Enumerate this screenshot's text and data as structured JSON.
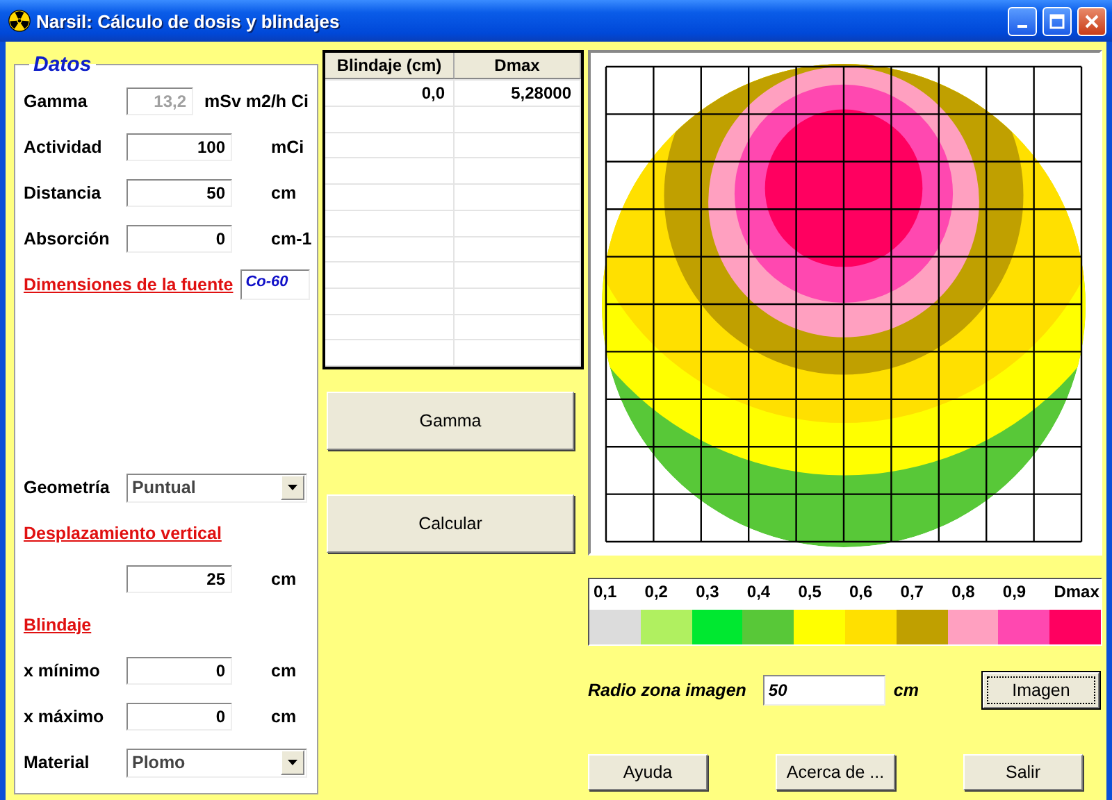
{
  "window": {
    "title": "Narsil: Cálculo de dosis y blindajes"
  },
  "datos": {
    "title": "Datos",
    "top": [
      {
        "kind": "field",
        "label": "Gamma",
        "value": "13,2",
        "unit": "mSv m2/h Ci",
        "disabled": true
      },
      {
        "kind": "field",
        "label": "Actividad",
        "value": "100",
        "unit": "mCi",
        "disabled": false
      },
      {
        "kind": "field",
        "label": "Distancia",
        "value": "50",
        "unit": "cm",
        "disabled": false
      },
      {
        "kind": "field",
        "label": "Absorción",
        "value": "0",
        "unit": "cm-1",
        "disabled": false
      },
      {
        "kind": "heading",
        "label": "Dimensiones de la fuente",
        "value": "Co-60"
      }
    ],
    "bottom": [
      {
        "kind": "select",
        "label": "Geometría",
        "value": "Puntual"
      },
      {
        "kind": "heading",
        "label": "Desplazamiento vertical"
      },
      {
        "kind": "field",
        "value": "25",
        "unit": "cm",
        "disabled": false
      },
      {
        "kind": "heading",
        "label": "Blindaje"
      },
      {
        "kind": "field",
        "label": "x mínimo",
        "value": "0",
        "unit": "cm",
        "disabled": false
      },
      {
        "kind": "field",
        "label": "x máximo",
        "value": "0",
        "unit": "cm",
        "disabled": false
      },
      {
        "kind": "select",
        "label": "Material",
        "value": "Plomo"
      }
    ]
  },
  "table": {
    "columns": [
      "Blindaje (cm)",
      "Dmax"
    ],
    "rows": [
      [
        "0,0",
        "5,28000"
      ]
    ]
  },
  "actions": [
    "Gamma",
    "Calcular"
  ],
  "legend": [
    {
      "label": "0,1",
      "color": "#dcdcdc"
    },
    {
      "label": "0,2",
      "color": "#b0f060"
    },
    {
      "label": "0,3",
      "color": "#00e830"
    },
    {
      "label": "0,4",
      "color": "#58c838"
    },
    {
      "label": "0,5",
      "color": "#ffff00"
    },
    {
      "label": "0,6",
      "color": "#ffe000"
    },
    {
      "label": "0,7",
      "color": "#c0a000"
    },
    {
      "label": "0,8",
      "color": "#ffa0c0"
    },
    {
      "label": "0,9",
      "color": "#ff48b0"
    },
    {
      "label": "Dmax",
      "color": "#ff0060"
    }
  ],
  "radius": {
    "label": "Radio zona imagen",
    "value": "50",
    "unit": "cm",
    "button": "Imagen",
    "focused": true
  },
  "footer": [
    "Ayuda",
    "Acerca de ...",
    "Salir"
  ]
}
